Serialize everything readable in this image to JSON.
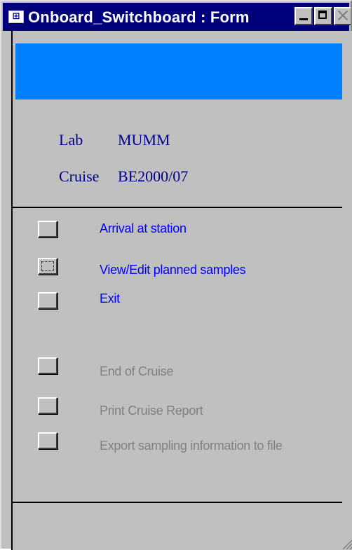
{
  "window": {
    "title": "Onboard_Switchboard : Form"
  },
  "info": {
    "lab_label": "Lab",
    "lab_value": "MUMM",
    "cruise_label": "Cruise",
    "cruise_value": "BE2000/07"
  },
  "options": [
    {
      "label": "Arrival at station",
      "enabled": true
    },
    {
      "label": "View/Edit planned samples",
      "enabled": true,
      "focused": true
    },
    {
      "label": "Exit",
      "enabled": true
    },
    {
      "label": "End of Cruise",
      "enabled": false
    },
    {
      "label": "Print Cruise Report",
      "enabled": false
    },
    {
      "label": "Export sampling information to file",
      "enabled": false
    }
  ],
  "colors": {
    "titlebar": "#00007b",
    "header_bar": "#0080ff",
    "info_text": "#00008b",
    "enabled_option": "#0000ff",
    "disabled_option": "#808080",
    "background": "#c0c0c0"
  }
}
